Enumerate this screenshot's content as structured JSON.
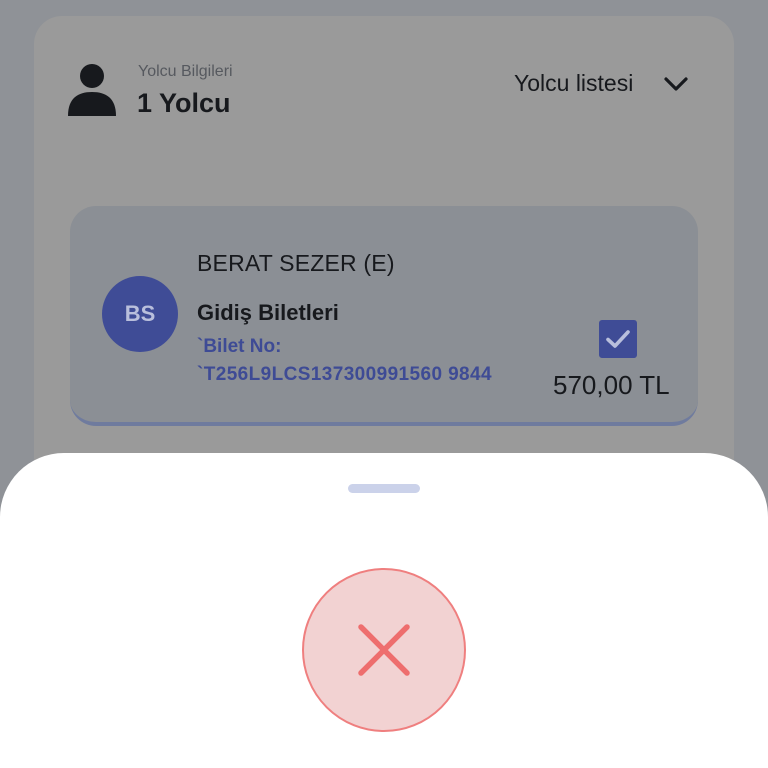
{
  "header": {
    "subtitle": "Yolcu Bilgileri",
    "passenger_count": "1 Yolcu",
    "list_toggle_label": "Yolcu listesi",
    "person_icon": "person-icon",
    "chevron_icon": "chevron-down-icon"
  },
  "passenger": {
    "initials": "BS",
    "name": "BERAT SEZER (E)",
    "ticket_type": "Gidiş Biletleri",
    "ticket_no_label": "`Bilet No:",
    "ticket_no": "`T256L9LCS137300991560 9844",
    "checked": true,
    "check_icon": "checkmark-icon",
    "price": "570,00 TL"
  },
  "sheet": {
    "status_icon": "close-icon",
    "status_color": "#ef7f7f"
  },
  "colors": {
    "accent": "#3f4c96",
    "error": "#ef7f7f",
    "error_bg": "#f2d2d2"
  }
}
